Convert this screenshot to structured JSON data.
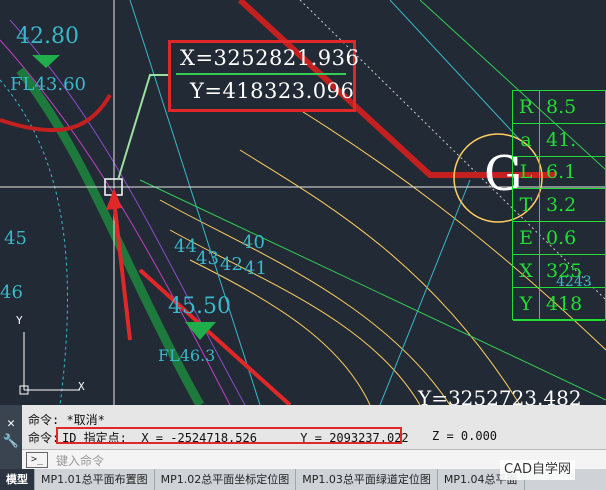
{
  "coords": {
    "x": "X=3252821.936",
    "y": "Y=418323.096"
  },
  "dims": {
    "d1": "42.80",
    "d2": "FL43.60",
    "d3": "45",
    "d4": "46",
    "d5": "44",
    "d6": "43",
    "d7": "42",
    "d8": "40",
    "d9": "41",
    "d10": "45.50",
    "d11": "FL46.3",
    "d12": "4243"
  },
  "curve_marker": "G",
  "curve_table": {
    "rows": [
      {
        "k": "R",
        "v": "8.5"
      },
      {
        "k": "a",
        "v": "41."
      },
      {
        "k": "L",
        "v": "6.1"
      },
      {
        "k": "T",
        "v": "3.2"
      },
      {
        "k": "E",
        "v": "0.6"
      },
      {
        "k": "X",
        "v": "325"
      },
      {
        "k": "Y",
        "v": "418"
      }
    ]
  },
  "bottom_coord": "Y=3252723.482",
  "command": {
    "line1": "命令: *取消*",
    "line2_prefix": "命令: ",
    "line2_id": "ID 指定点:  X = -2524718.526      Y = 2093237.022",
    "line2_z": "Z = 0.000",
    "placeholder": "键入命令",
    "side_close": "✕",
    "side_wrench": "🔧",
    "prompt_glyph": ">_"
  },
  "tabs": [
    {
      "label": "模型",
      "active": true
    },
    {
      "label": "MP1.01总平面布置图",
      "active": false
    },
    {
      "label": "MP1.02总平面坐标定位图",
      "active": false
    },
    {
      "label": "MP1.03总平面绿道定位图",
      "active": false
    },
    {
      "label": "MP1.04总平面",
      "active": false
    }
  ],
  "watermark": "CAD自学网",
  "axis": {
    "y": "Y",
    "x": "X"
  },
  "colors": {
    "background": "#222a35",
    "highlight": "#e02828",
    "table": "#22dd33",
    "dim": "#3ab7c8"
  }
}
